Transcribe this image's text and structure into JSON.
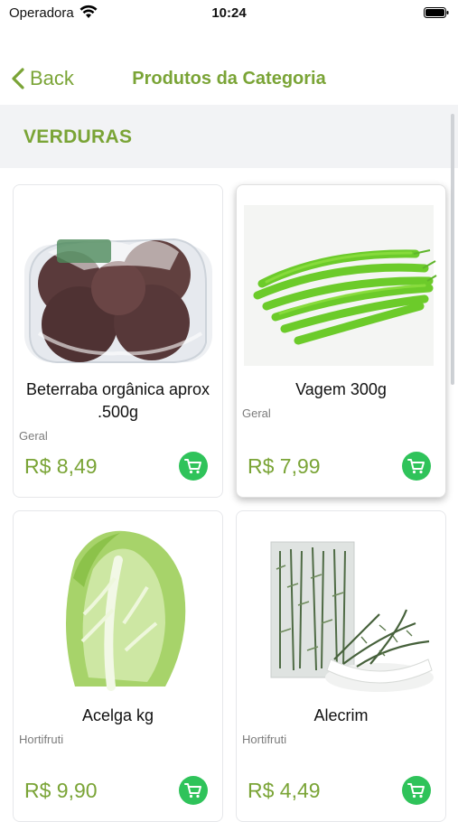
{
  "status_bar": {
    "carrier": "Operadora",
    "time": "10:24"
  },
  "nav": {
    "back_label": "Back",
    "title": "Produtos da Categoria"
  },
  "category": {
    "name": "VERDURAS"
  },
  "colors": {
    "accent": "#7aa436",
    "cart": "#2fc35a",
    "header_bg": "#f2f3f5"
  },
  "products": [
    {
      "name": "Beterraba orgânica aprox .500g",
      "category": "Geral",
      "price": "R$ 8,49",
      "image": "beetroot-image"
    },
    {
      "name": "Vagem 300g",
      "category": "Geral",
      "price": "R$ 7,99",
      "image": "green-beans-image"
    },
    {
      "name": "Acelga kg",
      "category": "Hortifruti",
      "price": "R$ 9,90",
      "image": "chinese-cabbage-image"
    },
    {
      "name": "Alecrim",
      "category": "Hortifruti",
      "price": "R$ 4,49",
      "image": "rosemary-image"
    }
  ]
}
